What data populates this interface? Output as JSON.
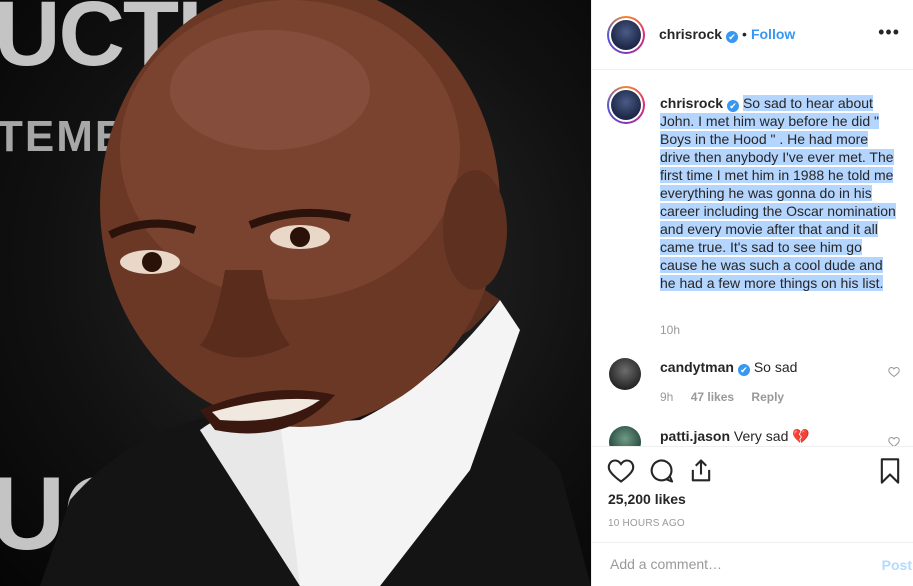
{
  "photo": {
    "backdrop_texts": [
      "UCTI",
      "TEMEI",
      "UCTI"
    ]
  },
  "header": {
    "username": "chrisrock",
    "verified_icon": "✔",
    "separator": "•",
    "follow_label": "Follow",
    "more_label": "•••"
  },
  "caption": {
    "username": "chrisrock",
    "text": "So sad to hear about John. I met him way before he did \" Boys in the Hood \" . He had more drive then anybody I've ever met. The first time I met him in 1988 he told me everything he was gonna do in his career including the Oscar nomination and every movie after that and it all came true. It's sad to see him go cause he was such a cool dude and he had a few more things on his list.",
    "time": "10h"
  },
  "comments": [
    {
      "username": "candytman",
      "text": "So sad",
      "time": "9h",
      "likes": "47 likes",
      "reply_label": "Reply"
    },
    {
      "username": "patti.jason",
      "text": "Very sad 💔"
    }
  ],
  "actions": {
    "likes_text": "25,200 likes",
    "posted_time": "10 HOURS AGO"
  },
  "add_comment": {
    "placeholder": "Add a comment…",
    "post_label": "Post"
  },
  "colors": {
    "accent": "#3897f0",
    "highlight": "#b4d5fe",
    "muted": "#999999"
  }
}
